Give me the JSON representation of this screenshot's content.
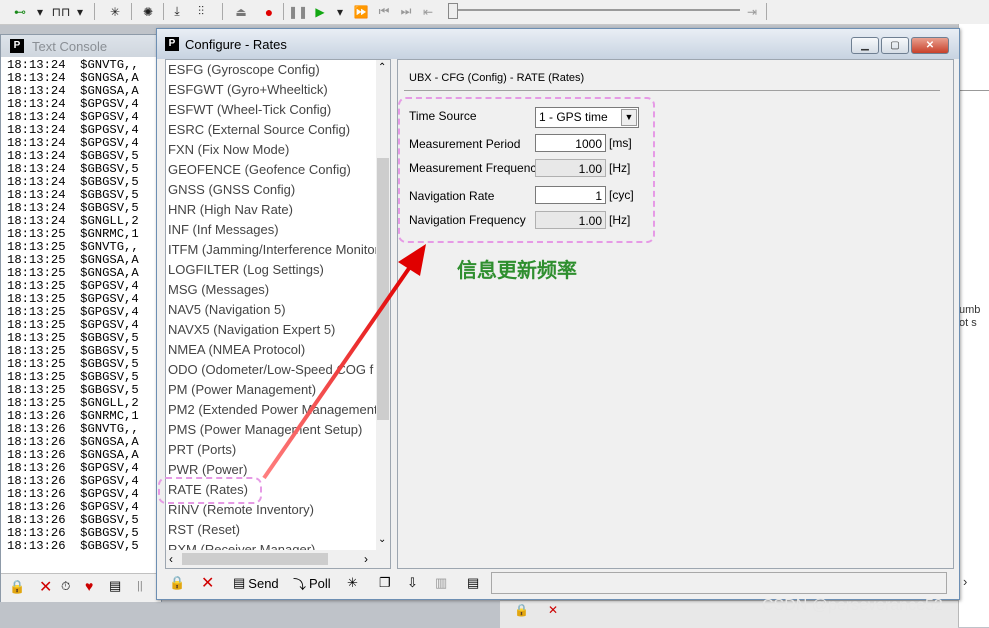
{
  "toolbar": {
    "icons": [
      "connect-icon",
      "dropdown-icon",
      "signal-icon",
      "dropdown-icon",
      "wand-icon",
      "bug-icon",
      "download-icon",
      "settings-sliders-icon",
      "eject-icon",
      "record-icon",
      "pause-icon",
      "play-icon",
      "dropdown-icon",
      "fast-forward-icon",
      "step-back-icon",
      "step-forward-icon",
      "skip-start-icon",
      "skip-end-icon"
    ]
  },
  "console": {
    "title": "Text Console",
    "lines": [
      "18:13:24  $GNVTG,,",
      "18:13:24  $GNGSA,A",
      "18:13:24  $GNGSA,A",
      "18:13:24  $GPGSV,4",
      "18:13:24  $GPGSV,4",
      "18:13:24  $GPGSV,4",
      "18:13:24  $GPGSV,4",
      "18:13:24  $GBGSV,5",
      "18:13:24  $GBGSV,5",
      "18:13:24  $GBGSV,5",
      "18:13:24  $GBGSV,5",
      "18:13:24  $GBGSV,5",
      "18:13:24  $GNGLL,2",
      "18:13:25  $GNRMC,1",
      "18:13:25  $GNVTG,,",
      "18:13:25  $GNGSA,A",
      "18:13:25  $GNGSA,A",
      "18:13:25  $GPGSV,4",
      "18:13:25  $GPGSV,4",
      "18:13:25  $GPGSV,4",
      "18:13:25  $GPGSV,4",
      "18:13:25  $GBGSV,5",
      "18:13:25  $GBGSV,5",
      "18:13:25  $GBGSV,5",
      "18:13:25  $GBGSV,5",
      "18:13:25  $GBGSV,5",
      "18:13:25  $GNGLL,2",
      "18:13:26  $GNRMC,1",
      "18:13:26  $GNVTG,,",
      "18:13:26  $GNGSA,A",
      "18:13:26  $GNGSA,A",
      "18:13:26  $GPGSV,4",
      "18:13:26  $GPGSV,4",
      "18:13:26  $GPGSV,4",
      "18:13:26  $GPGSV,4",
      "18:13:26  $GBGSV,5",
      "18:13:26  $GBGSV,5",
      "18:13:26  $GBGSV,5"
    ]
  },
  "configure": {
    "title": "Configure - Rates",
    "list_items": [
      "ESFG (Gyroscope Config)",
      "ESFGWT (Gyro+Wheeltick)",
      "ESFWT (Wheel-Tick Config)",
      "ESRC (External Source Config)",
      "FXN (Fix Now Mode)",
      "GEOFENCE (Geofence Config)",
      "GNSS (GNSS Config)",
      "HNR (High Nav Rate)",
      "INF (Inf Messages)",
      "ITFM (Jamming/Interference Monitor)",
      "LOGFILTER (Log Settings)",
      "MSG (Messages)",
      "NAV5 (Navigation 5)",
      "NAVX5 (Navigation Expert 5)",
      "NMEA (NMEA Protocol)",
      "ODO (Odometer/Low-Speed COG f",
      "PM (Power Management)",
      "PM2 (Extended Power Management",
      "PMS (Power Management Setup)",
      "PRT (Ports)",
      "PWR (Power)",
      "RATE (Rates)",
      "RINV (Remote Inventory)",
      "RST (Reset)",
      "RXM (Receiver Manager)"
    ],
    "panel_header": "UBX - CFG (Config) - RATE (Rates)",
    "time_source_label": "Time Source",
    "time_source_value": "1 - GPS time",
    "measurement_period_label": "Measurement Period",
    "measurement_period_value": "1000",
    "measurement_period_unit": "[ms]",
    "measurement_frequency_label": "Measurement Frequency",
    "measurement_frequency_value": "1.00",
    "measurement_frequency_unit": "[Hz]",
    "navigation_rate_label": "Navigation Rate",
    "navigation_rate_value": "1",
    "navigation_rate_unit": "[cyc]",
    "navigation_frequency_label": "Navigation Frequency",
    "navigation_frequency_value": "1.00",
    "navigation_frequency_unit": "[Hz]",
    "send_label": "Send",
    "poll_label": "Poll"
  },
  "annotation": {
    "text": "信息更新频率",
    "color": "#2f8f2f"
  },
  "right_partial": {
    "text1": "umb",
    "text2": "ot s"
  },
  "watermark": "CSDN @perseverance52"
}
